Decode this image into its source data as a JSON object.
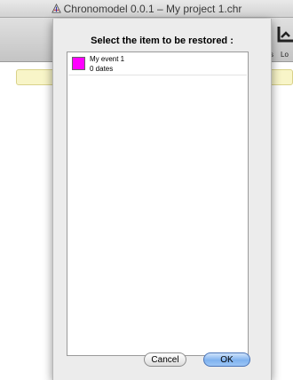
{
  "window": {
    "title": "Chronomodel 0.0.1 – My project 1.chr",
    "app_icon": "chronomodel-app-icon"
  },
  "toolbar": {
    "partial_label_left": "s",
    "partial_label_right": "Lo",
    "partial_icon": "chart-icon"
  },
  "dialog": {
    "title": "Select the item to be restored :",
    "items": [
      {
        "name": "My event 1",
        "subtitle": "0 dates",
        "color": "#ff00ff"
      }
    ],
    "cancel_label": "Cancel",
    "ok_label": "OK"
  },
  "colors": {
    "infobar": "#f8f5c8",
    "ok_button": "#7fb2ef"
  }
}
